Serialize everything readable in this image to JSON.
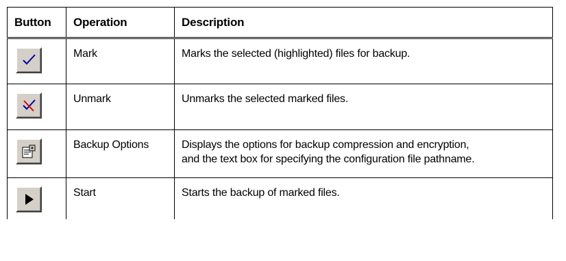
{
  "headers": {
    "button": "Button",
    "operation": "Operation",
    "description": "Description"
  },
  "rows": [
    {
      "icon": "checkmark-icon",
      "operation": "Mark",
      "description": [
        "Marks the selected (highlighted) files for backup."
      ]
    },
    {
      "icon": "crossed-checkmark-icon",
      "operation": "Unmark",
      "description": [
        "Unmarks the selected marked files."
      ]
    },
    {
      "icon": "properties-icon",
      "operation": "Backup Options",
      "description": [
        "Displays the options for backup compression and encryption,",
        "and the text box for specifying the configuration file pathname."
      ]
    },
    {
      "icon": "play-icon",
      "operation": "Start",
      "description": [
        "Starts the backup of marked files."
      ]
    }
  ],
  "colors": {
    "button_face": "#d4d0c8",
    "check_blue": "#0000a0",
    "cross_red": "#e00000"
  }
}
